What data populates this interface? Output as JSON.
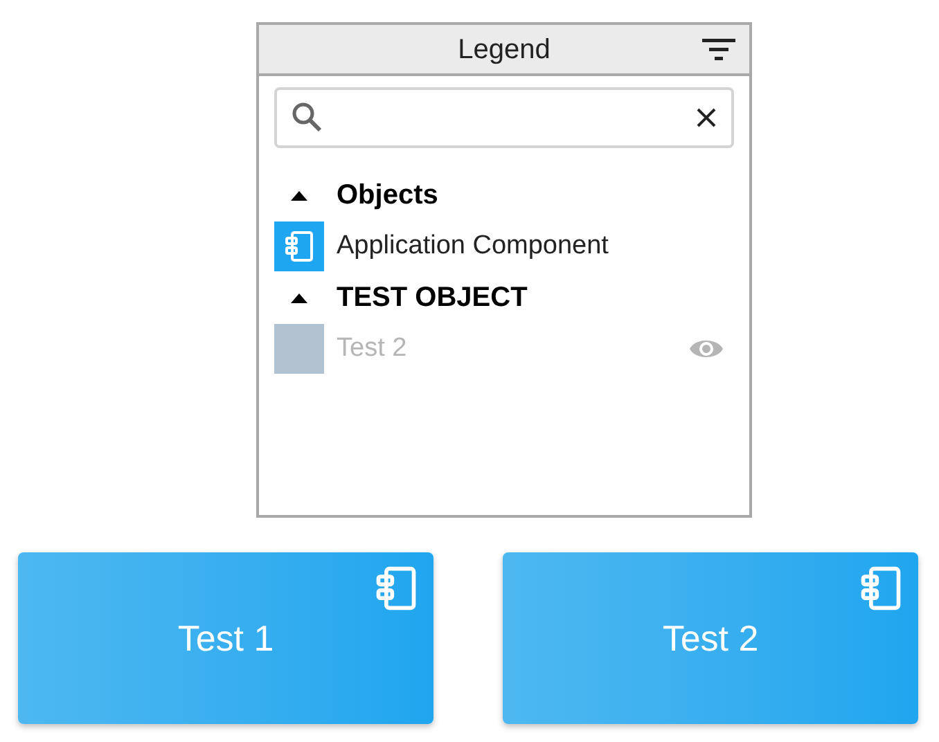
{
  "legend": {
    "title": "Legend",
    "groups": [
      {
        "label": "Objects",
        "expanded": true,
        "items": [
          {
            "label": "Application Component",
            "kind": "component",
            "color": "#1ea7f0",
            "visible": true
          }
        ]
      },
      {
        "label": "TEST OBJECT",
        "expanded": true,
        "items": [
          {
            "label": "Test 2",
            "kind": "blank",
            "color": "#b3c2d1",
            "visible": false
          }
        ]
      }
    ]
  },
  "cards": [
    {
      "label": "Test 1"
    },
    {
      "label": "Test 2"
    }
  ]
}
